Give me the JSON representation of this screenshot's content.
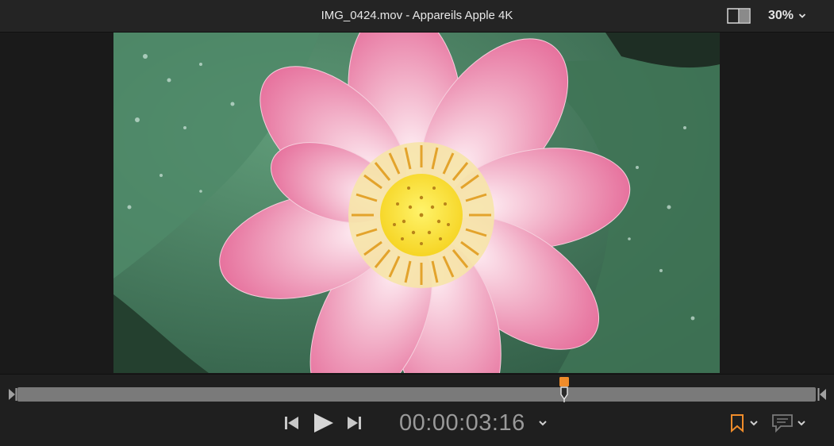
{
  "window": {
    "title": "IMG_0424.mov - Appareils Apple 4K",
    "zoom_level": "30%"
  },
  "viewer": {
    "image": "pink lotus flower with water droplets on lily pads"
  },
  "transport": {
    "timecode": "00:00:03:16",
    "playhead_position": 0.685
  },
  "colors": {
    "accent_orange": "#f08c2a",
    "background": "#1b1b1b",
    "scrub_bar": "#7a7a7a"
  },
  "icons": [
    "view-toggle-icon",
    "chevron-down-icon",
    "skip-back-icon",
    "play-icon",
    "skip-forward-icon",
    "bookmark-icon",
    "comment-icon"
  ]
}
